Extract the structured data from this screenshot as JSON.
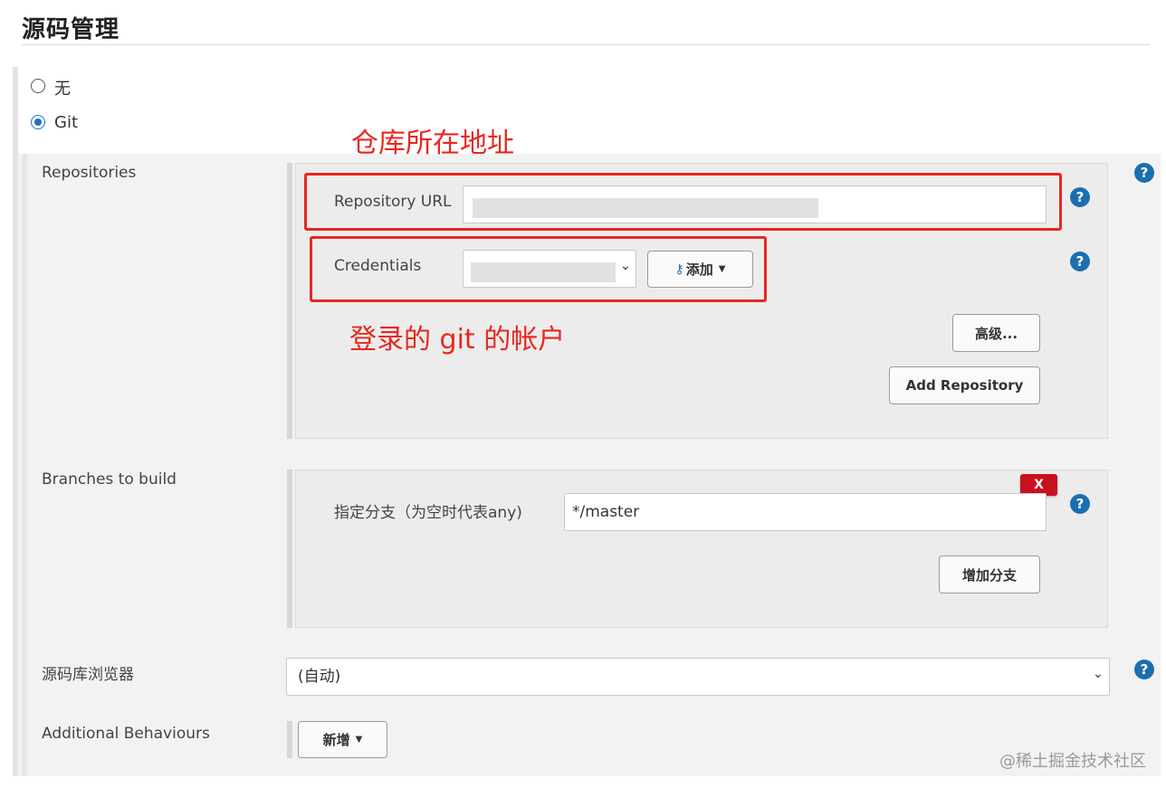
{
  "section": {
    "title": "源码管理"
  },
  "scm_options": [
    {
      "label": "无",
      "selected": false
    },
    {
      "label": "Git",
      "selected": true
    }
  ],
  "repositories": {
    "label": "Repositories",
    "repository_url_label": "Repository URL",
    "credentials_label": "Credentials",
    "add_button": "添加",
    "advanced_button": "高级...",
    "add_repository_button": "Add Repository"
  },
  "branches": {
    "label": "Branches to build",
    "branch_field_label": "指定分支（为空时代表any)",
    "branch_value": "*/master",
    "delete_label": "X",
    "add_branch_button": "增加分支"
  },
  "browser": {
    "label": "源码库浏览器",
    "selected": "(自动)"
  },
  "behaviours": {
    "label": "Additional Behaviours",
    "add_button": "新增"
  },
  "annotations": {
    "repo_address": "仓库所在地址",
    "git_account": "登录的 git 的帐户"
  },
  "help_glyph": "?",
  "watermark": "@稀土掘金技术社区",
  "colors": {
    "annotation_red": "#e8271f",
    "help_blue": "#1b6fae",
    "radio_blue": "#1e6fd0",
    "delete_red": "#c8101e"
  }
}
